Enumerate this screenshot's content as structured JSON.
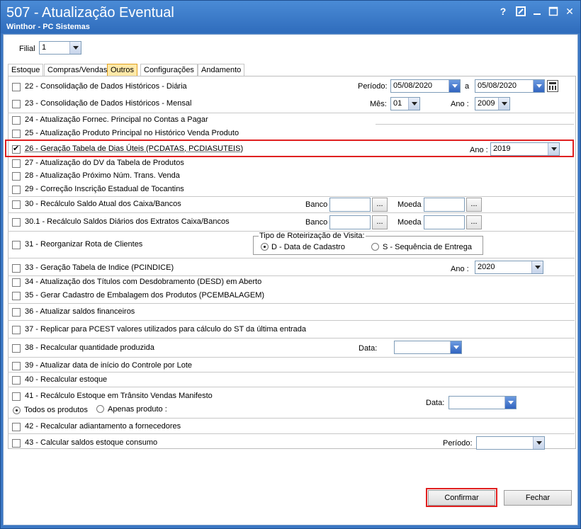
{
  "window": {
    "title": "507 - Atualização Eventual",
    "subtitle": "Winthor - PC Sistemas"
  },
  "filial": {
    "label": "Filial",
    "value": "1"
  },
  "tabs": [
    {
      "label": "Estoque",
      "active": false
    },
    {
      "label": "Compras/Vendas",
      "active": false
    },
    {
      "label": "Outros",
      "active": true
    },
    {
      "label": "Configurações",
      "active": false
    },
    {
      "label": "Andamento",
      "active": false
    }
  ],
  "rows": {
    "r22": {
      "label": "22 - Consolidação de Dados Históricos - Diária",
      "checked": false,
      "periodo_label": "Período:",
      "date_from": "05/08/2020",
      "a_label": "a",
      "date_to": "05/08/2020"
    },
    "r23": {
      "label": "23 - Consolidação de Dados Históricos - Mensal",
      "checked": false,
      "mes_label": "Mês:",
      "mes_value": "01",
      "ano_label": "Ano :",
      "ano_value": "2009"
    },
    "r24": {
      "label": "24 - Atualização Fornec. Principal no Contas a Pagar",
      "checked": false
    },
    "r25": {
      "label": "25 - Atualização Produto Principal no Histórico Venda Produto",
      "checked": false
    },
    "r26": {
      "label": "26 - Geração Tabela de Dias Úteis (PCDATAS, PCDIASUTEIS)",
      "checked": true,
      "ano_label": "Ano :",
      "ano_value": "2019"
    },
    "r27": {
      "label": "27 - Atualização do DV da Tabela de Produtos",
      "checked": false
    },
    "r28": {
      "label": "28 - Atualização Próximo Núm. Trans. Venda",
      "checked": false
    },
    "r29": {
      "label": "29 - Correção Inscrição Estadual de Tocantins",
      "checked": false
    },
    "r30": {
      "label": "30 - Recálculo Saldo Atual dos Caixa/Bancos",
      "checked": false,
      "banco_label": "Banco",
      "moeda_label": "Moeda",
      "ellipsis": "..."
    },
    "r30_1": {
      "label": "30.1 - Recálculo Saldos Diários dos Extratos Caixa/Bancos",
      "checked": false,
      "banco_label": "Banco",
      "moeda_label": "Moeda",
      "ellipsis": "..."
    },
    "r31": {
      "label": "31 - Reorganizar Rota de Clientes",
      "checked": false,
      "group_label": "Tipo de Roteirização de Visita:",
      "opt_d": "D - Data de Cadastro",
      "opt_s": "S - Sequência de Entrega",
      "selected": "D"
    },
    "r33": {
      "label": "33 - Geração Tabela de Indice (PCINDICE)",
      "checked": false,
      "ano_label": "Ano :",
      "ano_value": "2020"
    },
    "r34": {
      "label": "34 - Atualização dos Títulos com Desdobramento (DESD) em Aberto",
      "checked": false
    },
    "r35": {
      "label": "35 - Gerar Cadastro de Embalagem dos Produtos (PCEMBALAGEM)",
      "checked": false
    },
    "r36": {
      "label": "36 - Atualizar saldos financeiros",
      "checked": false
    },
    "r37": {
      "label": "37 - Replicar para PCEST valores utilizados para cálculo do ST da última entrada",
      "checked": false
    },
    "r38": {
      "label": "38 - Recalcular quantidade produzida",
      "checked": false,
      "data_label": "Data:",
      "data_value": ""
    },
    "r39": {
      "label": "39 - Atualizar data de início do Controle por Lote",
      "checked": false
    },
    "r40": {
      "label": "40 - Recalcular estoque",
      "checked": false
    },
    "r41": {
      "label": "41 - Recálculo Estoque em Trânsito Vendas Manifesto",
      "checked": false,
      "opt_todos": "Todos os produtos",
      "opt_apenas": "Apenas produto :",
      "selected": "todos",
      "data_label": "Data:",
      "data_value": ""
    },
    "r42": {
      "label": "42 - Recalcular adiantamento a fornecedores",
      "checked": false
    },
    "r43": {
      "label": "43 - Calcular saldos estoque consumo",
      "checked": false,
      "periodo_label": "Período:",
      "periodo_value": ""
    }
  },
  "buttons": {
    "confirmar": "Confirmar",
    "fechar": "Fechar"
  },
  "colors": {
    "titlebar": "#3b78c4",
    "highlight": "#e02020",
    "active_tab": "#ffe9a8"
  }
}
